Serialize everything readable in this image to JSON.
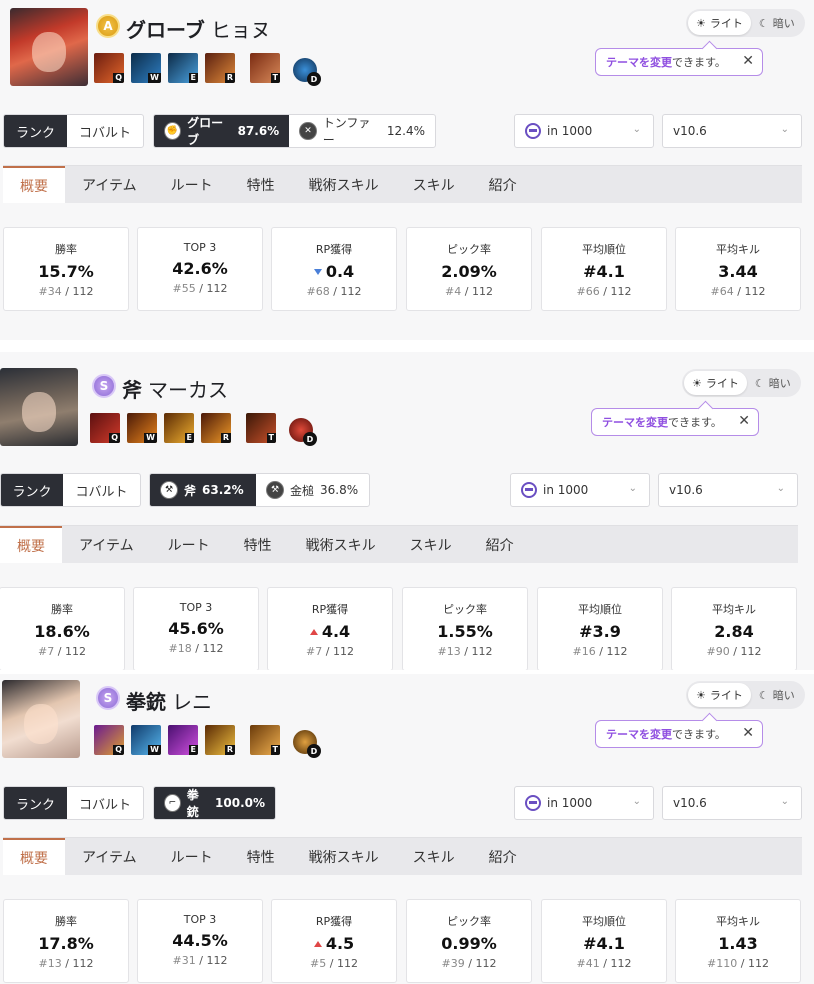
{
  "colors": {
    "accent": "#c0704a",
    "dark": "#2c2e35",
    "tooltip_border": "#b58ce8",
    "up": "#e04646",
    "down": "#4a7fd8"
  },
  "common": {
    "theme_light": "ライト",
    "theme_dark": "暗い",
    "tooltip_highlight": "テーマを変更",
    "tooltip_rest": "できます。",
    "tooltip_close": "✕",
    "mode_rank": "ランク",
    "mode_cobalt": "コバルト",
    "rank_filter": "in 1000",
    "version": "v10.6",
    "skill_keys": [
      "Q",
      "W",
      "E",
      "R",
      "T",
      "D"
    ],
    "tabs": [
      "概要",
      "アイテム",
      "ルート",
      "特性",
      "戦術スキル",
      "スキル",
      "紹介"
    ],
    "stat_labels": [
      "勝率",
      "TOP 3",
      "RP獲得",
      "ピック率",
      "平均順位",
      "平均キル"
    ]
  },
  "characters": [
    {
      "tier": "A",
      "weapon": "グローブ",
      "name": "ヒョヌ",
      "weapons": [
        {
          "name": "グローブ",
          "pct": "87.6%",
          "icon": "glove-icon"
        },
        {
          "name": "トンファー",
          "pct": "12.4%",
          "icon": "tonfa-icon"
        }
      ],
      "stats": [
        {
          "value": "15.7%",
          "pos": "#34",
          "total": "/ 112"
        },
        {
          "value": "42.6%",
          "pos": "#55",
          "total": "/ 112"
        },
        {
          "value": "0.4",
          "pos": "#68",
          "total": "/ 112",
          "trend": "down"
        },
        {
          "value": "2.09%",
          "pos": "#4",
          "total": "/ 112"
        },
        {
          "value": "#4.1",
          "pos": "#66",
          "total": "/ 112"
        },
        {
          "value": "3.44",
          "pos": "#64",
          "total": "/ 112"
        }
      ]
    },
    {
      "tier": "S",
      "weapon": "斧",
      "name": "マーカス",
      "weapons": [
        {
          "name": "斧",
          "pct": "63.2%",
          "icon": "axe-icon"
        },
        {
          "name": "金槌",
          "pct": "36.8%",
          "icon": "hammer-icon"
        }
      ],
      "stats": [
        {
          "value": "18.6%",
          "pos": "#7",
          "total": "/ 112"
        },
        {
          "value": "45.6%",
          "pos": "#18",
          "total": "/ 112"
        },
        {
          "value": "4.4",
          "pos": "#7",
          "total": "/ 112",
          "trend": "up"
        },
        {
          "value": "1.55%",
          "pos": "#13",
          "total": "/ 112"
        },
        {
          "value": "#3.9",
          "pos": "#16",
          "total": "/ 112"
        },
        {
          "value": "2.84",
          "pos": "#90",
          "total": "/ 112"
        }
      ]
    },
    {
      "tier": "S",
      "weapon": "拳銃",
      "name": "レニ",
      "weapons": [
        {
          "name": "拳銃",
          "pct": "100.0%",
          "icon": "pistol-icon"
        }
      ],
      "stats": [
        {
          "value": "17.8%",
          "pos": "#13",
          "total": "/ 112"
        },
        {
          "value": "44.5%",
          "pos": "#31",
          "total": "/ 112"
        },
        {
          "value": "4.5",
          "pos": "#5",
          "total": "/ 112",
          "trend": "up"
        },
        {
          "value": "0.99%",
          "pos": "#39",
          "total": "/ 112"
        },
        {
          "value": "#4.1",
          "pos": "#41",
          "total": "/ 112"
        },
        {
          "value": "1.43",
          "pos": "#110",
          "total": "/ 112"
        }
      ]
    }
  ]
}
